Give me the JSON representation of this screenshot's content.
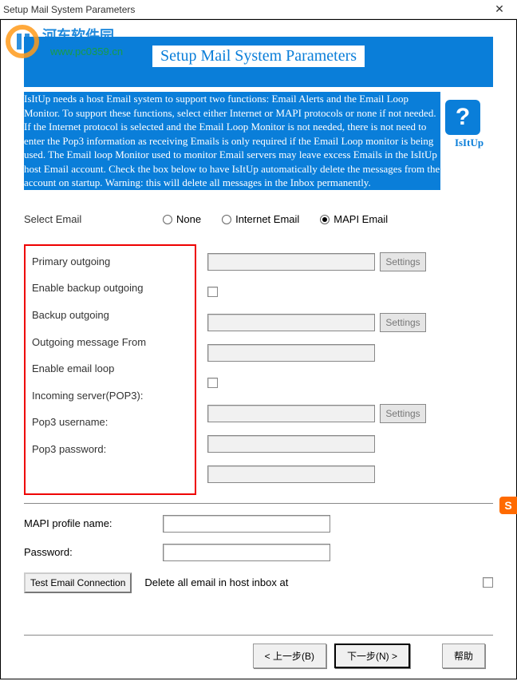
{
  "window": {
    "title": "Setup Mail System Parameters"
  },
  "watermark": {
    "brand": "河东软件园",
    "url": "www.pc0359.cn"
  },
  "banner": {
    "title": "Setup Mail System Parameters"
  },
  "description": "IsItUp needs a host Email system to support two functions: Email Alerts and the Email Loop Monitor. To support these functions, select either Internet or MAPI protocols or none if not needed. If the Internet protocol is selected and the Email Loop Monitor is not needed, there is not need to enter the Pop3 information as receiving Emails is only required if the Email Loop monitor is being used. The Email loop Monitor used to monitor Email servers may leave excess Emails in the IsItUp host Email account. Check the box below to have IsItUp automatically delete the messages from the account on startup. Warning: this will delete all messages in the Inbox permanently.",
  "logo": {
    "q": "?",
    "label": "IsItUp"
  },
  "select_email": {
    "label": "Select Email",
    "options": [
      "None",
      "Internet Email",
      "MAPI Email"
    ],
    "selected": "MAPI Email"
  },
  "fields": {
    "primary_outgoing": "Primary outgoing",
    "enable_backup": "Enable backup outgoing",
    "backup_outgoing": "Backup outgoing",
    "outgoing_from": "Outgoing message From",
    "enable_loop": "Enable email loop",
    "incoming_pop3": "Incoming server(POP3):",
    "pop3_user": "Pop3 username:",
    "pop3_pass": "Pop3 password:"
  },
  "settings_btn": "Settings",
  "mapi": {
    "profile_label": "MAPI profile name:",
    "password_label": "Password:",
    "profile_value": "",
    "password_value": ""
  },
  "test_btn": "Test Email Connection",
  "delete_label": "Delete all email in host inbox at",
  "nav": {
    "back": "< 上一步(B)",
    "next": "下一步(N) >",
    "help": "帮助"
  },
  "side_badge": "S"
}
